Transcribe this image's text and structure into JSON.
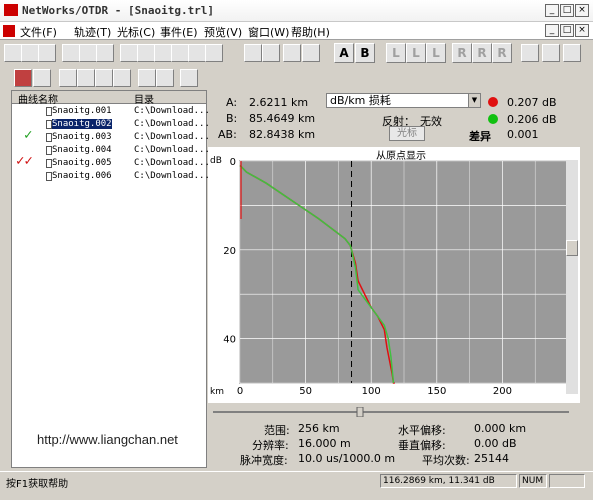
{
  "window": {
    "title": "NetWorks/OTDR - [Snaoitg.trl]"
  },
  "menu": [
    "文件(F)",
    "轨迹(T)",
    "光标(C)",
    "事件(E)",
    "预览(V)",
    "窗口(W)",
    "帮助(H)"
  ],
  "trace_list": {
    "col_name": "曲线名称",
    "col_dir": "目录",
    "items": [
      {
        "name": "Snaoitg.001",
        "dir": "C:\\Download...",
        "mark": ""
      },
      {
        "name": "Snaoitg.002",
        "dir": "C:\\Download...",
        "mark": ""
      },
      {
        "name": "Snaoitg.003",
        "dir": "C:\\Download...",
        "mark": "✓"
      },
      {
        "name": "Snaoitg.004",
        "dir": "C:\\Download...",
        "mark": ""
      },
      {
        "name": "Snaoitg.005",
        "dir": "C:\\Download...",
        "mark": "✓✓"
      },
      {
        "name": "Snaoitg.006",
        "dir": "C:\\Download...",
        "mark": ""
      }
    ]
  },
  "info": {
    "a_label": "A:",
    "a_value": "2.6211 km",
    "b_label": "B:",
    "b_value": "85.4649 km",
    "ab_label": "AB:",
    "ab_value": "82.8438 km",
    "mode": "dB/km 损耗",
    "reflection_label": "反射：",
    "reflection_value": "无效",
    "cursor_btn": "光标",
    "diff_label": "差异",
    "diff_value": "0.001",
    "red_value": "0.207 dB",
    "green_value": "0.206 dB",
    "red_color": "#e01010",
    "green_color": "#10c010"
  },
  "chart_data": {
    "type": "line",
    "title": "从原点显示",
    "ylabel": "dB",
    "xlabel": "km",
    "xlim": [
      0,
      250
    ],
    "ylim": [
      0,
      50
    ],
    "xticks": [
      0,
      50,
      100,
      150,
      200
    ],
    "yticks": [
      0,
      20,
      40
    ],
    "cursor_dashed_x": 85,
    "series": [
      {
        "color": "#e01010",
        "x": [
          0,
          5,
          20,
          40,
          60,
          80,
          84,
          85,
          86,
          88,
          90,
          95,
          100,
          105,
          110,
          112,
          114,
          116,
          117,
          118
        ],
        "y": [
          1,
          2.5,
          5,
          9,
          13,
          17.5,
          19,
          20,
          21,
          23,
          27,
          30,
          33,
          35,
          38,
          42,
          45,
          48,
          50,
          50
        ]
      },
      {
        "color": "#40c040",
        "x": [
          0,
          5,
          20,
          40,
          60,
          80,
          84,
          85,
          88,
          90,
          95,
          100,
          105,
          110,
          113,
          115,
          117
        ],
        "y": [
          1,
          2.5,
          5,
          9,
          13,
          17.5,
          19,
          20,
          24,
          29,
          31,
          33,
          35,
          37,
          40,
          44,
          50
        ]
      }
    ]
  },
  "bottom": {
    "range_label": "范围:",
    "range_value": "256 km",
    "res_label": "分辨率:",
    "res_value": "16.000 m",
    "pulse_label": "脉冲宽度:",
    "pulse_value": "10.0 us/1000.0 m",
    "hoffset_label": "水平偏移:",
    "hoffset_value": "0.000 km",
    "voffset_label": "垂直偏移:",
    "voffset_value": "0.00 dB",
    "avg_label": "平均次数:",
    "avg_value": "25144"
  },
  "status": {
    "help": "按F1获取帮助",
    "coord": "116.2869 km, 11.341 dB",
    "cap": "NUM"
  },
  "watermark": "http://www.liangchan.net"
}
